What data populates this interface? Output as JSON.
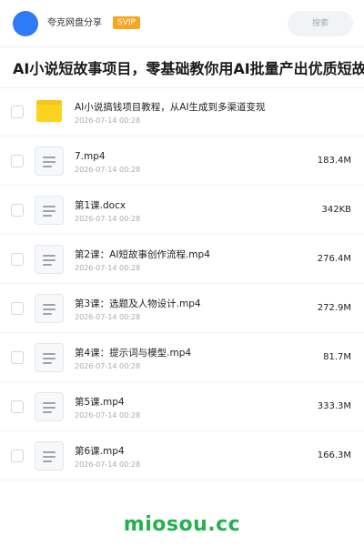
{
  "header": {
    "brand": "夸克网盘分享",
    "badge": "SVIP",
    "search_placeholder": "搜索",
    "accent_color": "#2f7bf6",
    "badge_color": "#f5a623"
  },
  "title": "AI小说短故事项目，零基础教你用AI批量产出优质短故事，",
  "files": [
    {
      "type": "folder",
      "icon": "folder-icon",
      "name": "AI小说搞钱项目教程，从AI生成到多渠道变现",
      "date": "2026-07-14 00:28",
      "size": ""
    },
    {
      "type": "file",
      "icon": "file-icon",
      "name": "7.mp4",
      "date": "2026-07-14 00:28",
      "size": "183.4M"
    },
    {
      "type": "file",
      "icon": "file-icon",
      "name": "第1课.docx",
      "date": "2026-07-14 00:28",
      "size": "342KB"
    },
    {
      "type": "file",
      "icon": "file-icon",
      "name": "第2课：AI短故事创作流程.mp4",
      "date": "2026-07-14 00:28",
      "size": "276.4M"
    },
    {
      "type": "file",
      "icon": "file-icon",
      "name": "第3课：选题及人物设计.mp4",
      "date": "2026-07-14 00:28",
      "size": "272.9M"
    },
    {
      "type": "file",
      "icon": "file-icon",
      "name": "第4课：提示词与模型.mp4",
      "date": "2026-07-14 00:28",
      "size": "81.7M"
    },
    {
      "type": "file",
      "icon": "file-icon",
      "name": "第5课.mp4",
      "date": "2026-07-14 00:28",
      "size": "333.3M"
    },
    {
      "type": "file",
      "icon": "file-icon",
      "name": "第6课.mp4",
      "date": "2026-07-14 00:28",
      "size": "166.3M"
    }
  ],
  "watermark": {
    "text": "miosou.cc",
    "color": "#23b14d"
  }
}
